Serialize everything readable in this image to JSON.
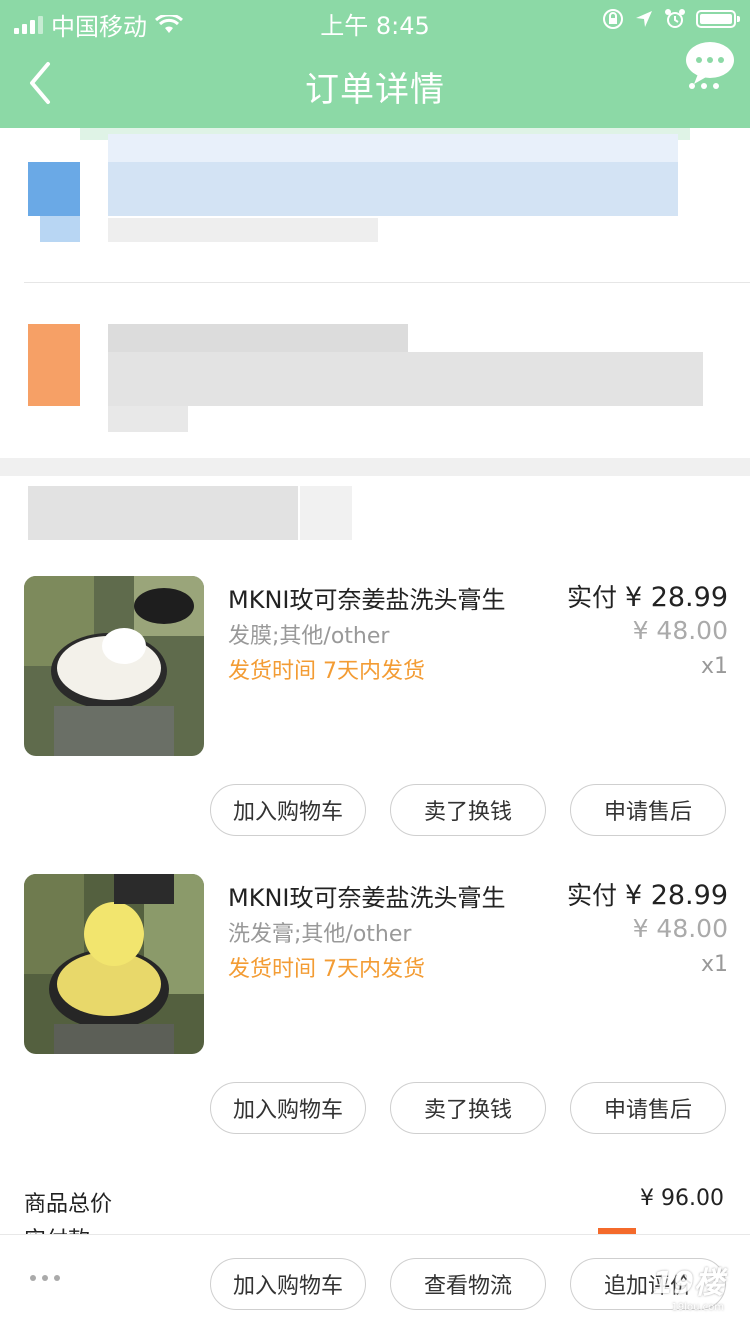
{
  "status_bar": {
    "carrier": "中国移动",
    "time": "上午 8:45"
  },
  "nav": {
    "title": "订单详情"
  },
  "items": [
    {
      "title": "MKNI玫可奈姜盐洗头膏生",
      "sku": "发膜;其他/other",
      "shipping": "发货时间 7天内发货",
      "paid_label": "实付",
      "paid_price": "¥ 28.99",
      "original_price": "¥ 48.00",
      "quantity": "x1",
      "buttons": [
        "加入购物车",
        "卖了换钱",
        "申请售后"
      ]
    },
    {
      "title": "MKNI玫可奈姜盐洗头膏生",
      "sku": "洗发膏;其他/other",
      "shipping": "发货时间 7天内发货",
      "paid_label": "实付",
      "paid_price": "¥ 28.99",
      "original_price": "¥ 48.00",
      "quantity": "x1",
      "buttons": [
        "加入购物车",
        "卖了换钱",
        "申请售后"
      ]
    }
  ],
  "summary": {
    "total_label": "商品总价",
    "total_value": "¥ 96.00",
    "partial_label": "实付款"
  },
  "bottom_bar": {
    "buttons": [
      "加入购物车",
      "查看物流",
      "追加评价"
    ]
  },
  "watermark": {
    "text": "19楼",
    "sub": "19lou.com"
  },
  "colors": {
    "header": "#8cd9a6",
    "shipping": "#f39c34",
    "accent_red": "#f46a2b"
  }
}
